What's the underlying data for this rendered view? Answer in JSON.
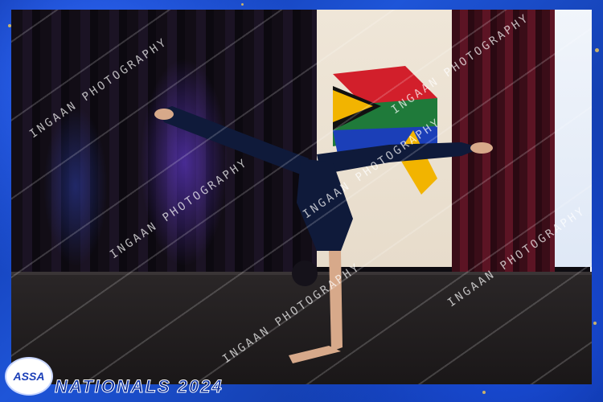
{
  "image": {
    "subject": "gymnast performing one-handed split handstand on stage",
    "frame_accent_color": "#1e55d8",
    "photo_border_color": "#ffffff"
  },
  "watermark": {
    "text": "INGAAN PHOTOGRAPHY"
  },
  "branding": {
    "logo_text": "ASSA",
    "event_title": "NATIONALS 2024"
  }
}
